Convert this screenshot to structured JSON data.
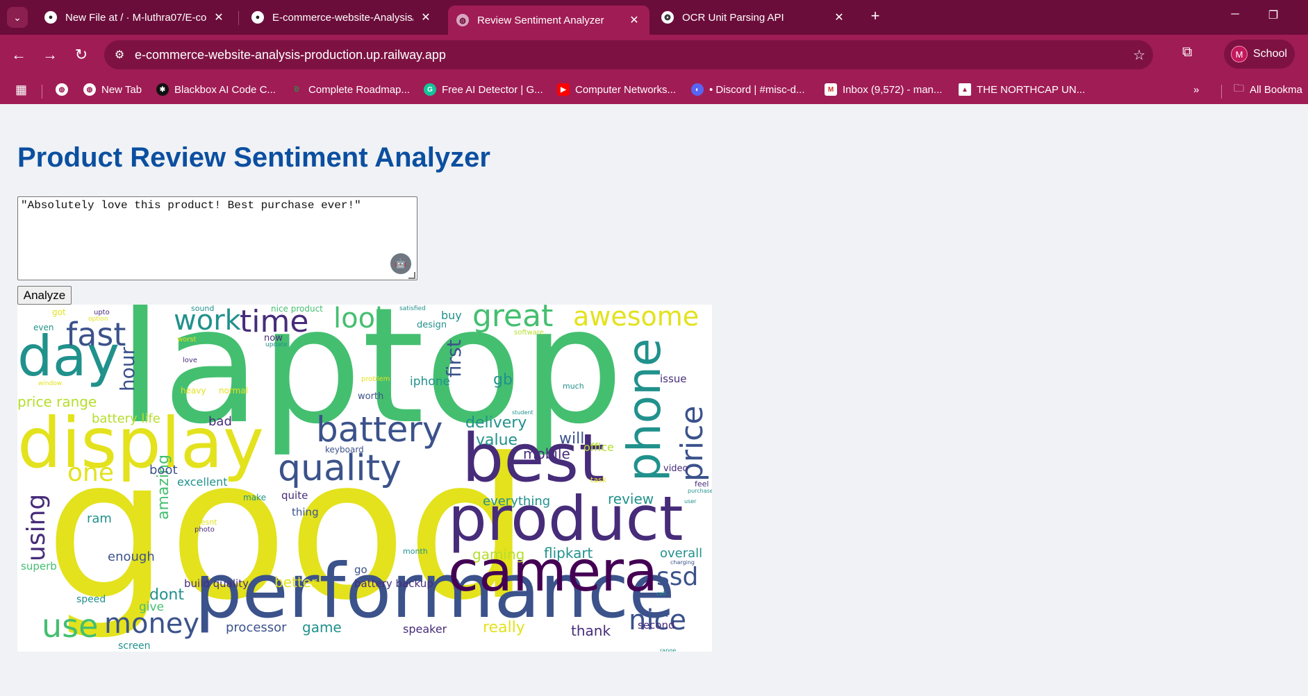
{
  "browser": {
    "tabs": [
      {
        "label": "New File at / · M-luthra07/E-com",
        "icon": "github-icon",
        "active": false
      },
      {
        "label": "E-commerce-website-Analysis/f",
        "icon": "github-icon",
        "active": false
      },
      {
        "label": "Review Sentiment Analyzer",
        "icon": "globe-icon",
        "active": true
      },
      {
        "label": "OCR Unit Parsing API",
        "icon": "openai-icon",
        "active": false
      }
    ],
    "url": "e-commerce-website-analysis-production.up.railway.app",
    "profile": {
      "initial": "M",
      "label": "School"
    },
    "bookmarks": [
      {
        "label": "",
        "icon": "globe-icon"
      },
      {
        "label": "New Tab",
        "icon": "globe-icon"
      },
      {
        "label": "Blackbox AI Code C...",
        "icon": "blackbox-icon"
      },
      {
        "label": "Complete Roadmap...",
        "icon": "gfg-icon"
      },
      {
        "label": "Free AI Detector | G...",
        "icon": "grammarly-icon"
      },
      {
        "label": "Computer Networks...",
        "icon": "youtube-icon"
      },
      {
        "label": "• Discord | #misc-d...",
        "icon": "discord-icon"
      },
      {
        "label": "Inbox (9,572) - man...",
        "icon": "gmail-icon"
      },
      {
        "label": "THE NORTHCAP UN...",
        "icon": "ncu-icon"
      }
    ],
    "all_bookmarks_label": "All Bookma"
  },
  "page": {
    "title": "Product Review Sentiment Analyzer",
    "review_text": "\"Absolutely love this product! Best purchase ever!\"",
    "analyze_label": "Analyze"
  },
  "wordcloud": {
    "colors": {
      "yellow": "#e3e21d",
      "green": "#44bf70",
      "teal": "#21918c",
      "blue": "#3b528b",
      "purple": "#472c7a",
      "lime": "#b5de2b",
      "dark": "#440154"
    },
    "words": [
      "laptop",
      "good",
      "display",
      "performance",
      "best",
      "product",
      "camera",
      "phone",
      "battery",
      "quality",
      "day",
      "fast",
      "time",
      "work",
      "look",
      "great",
      "awesome",
      "price",
      "use",
      "money",
      "nice",
      "ssd",
      "one",
      "using",
      "hour",
      "first",
      "gb",
      "iphone",
      "delivery",
      "value",
      "will",
      "mobile",
      "office",
      "amazing",
      "boot",
      "excellent",
      "ram",
      "enough",
      "superb",
      "speed",
      "dont",
      "better",
      "build quality",
      "battery backup",
      "give",
      "processor",
      "game",
      "really",
      "speaker",
      "thank",
      "second",
      "review",
      "overall",
      "gaming",
      "flipkart",
      "everything",
      "price range",
      "battery life",
      "bad",
      "heavy",
      "normal",
      "worth",
      "issue",
      "much",
      "screen",
      "nice product",
      "sound",
      "got",
      "even",
      "upto",
      "option",
      "worst",
      "now",
      "update",
      "satisfied",
      "buy",
      "design",
      "software",
      "love",
      "window",
      "problem",
      "student",
      "keyboard",
      "make",
      "quite",
      "thing",
      "month",
      "go",
      "photo",
      "doesnt",
      "video",
      "feel",
      "task",
      "purchase",
      "user",
      "charging",
      "call",
      "thank",
      "range"
    ]
  }
}
